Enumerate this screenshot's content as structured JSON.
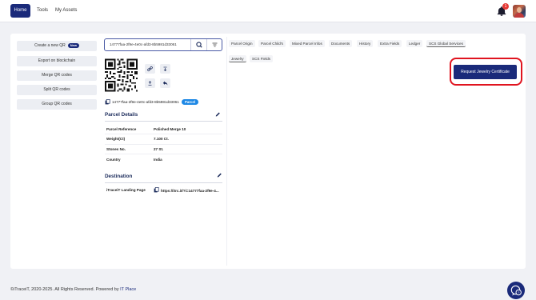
{
  "nav": {
    "items": [
      {
        "label": "Home",
        "active": true
      },
      {
        "label": "Tools"
      },
      {
        "label": "My Assets"
      }
    ],
    "notification_count": "1"
  },
  "sidebar": {
    "items": [
      {
        "label": "Create a new QR",
        "badge": "New"
      },
      {
        "label": "Export on blockchain"
      },
      {
        "label": "Merge QR codes"
      },
      {
        "label": "Split QR codes"
      },
      {
        "label": "Group QR codes"
      }
    ]
  },
  "search": {
    "value": "14777faa-2f9e-4e0c-afd3-8b5981d33061"
  },
  "asset": {
    "code": "14777faa-2f9e-4e0c-afd3-8b5981d33061",
    "type_badge": "Parcel"
  },
  "parcel_details": {
    "title": "Parcel Details",
    "rows": [
      {
        "key": "Parcel Reference",
        "value": "Polished Merge 10"
      },
      {
        "key": "Weight(Ct)",
        "value": "7.100 Ct."
      },
      {
        "key": "Stones No.",
        "value": "27 St."
      },
      {
        "key": "Country",
        "value": "India"
      }
    ]
  },
  "destination": {
    "title": "Destination",
    "key": "iTraceiT Landing Page",
    "value": "https://itrc.it/?i=14777faa-2f9e-4..."
  },
  "tabs": [
    {
      "label": "Parcel Origin"
    },
    {
      "label": "Parcel Child's"
    },
    {
      "label": "Mixed Parcel Infos"
    },
    {
      "label": "Documents"
    },
    {
      "label": "History"
    },
    {
      "label": "Extra Fields"
    },
    {
      "label": "Ledger"
    },
    {
      "label": "SCS Global Services",
      "active": true
    }
  ],
  "subtabs": [
    {
      "label": "Jewelry",
      "active": true
    },
    {
      "label": "SCS Fields"
    }
  ],
  "actions": {
    "request_certificate": "Request Jewelry Certificate"
  },
  "footer": {
    "text": "©iTraceiT, 2020-2025. All Rights Reserved. Powered by ",
    "link": "IT Place"
  },
  "colors": {
    "brand": "#1a2a7a",
    "highlight": "#e0141f",
    "badge_blue": "#1e88e5"
  }
}
